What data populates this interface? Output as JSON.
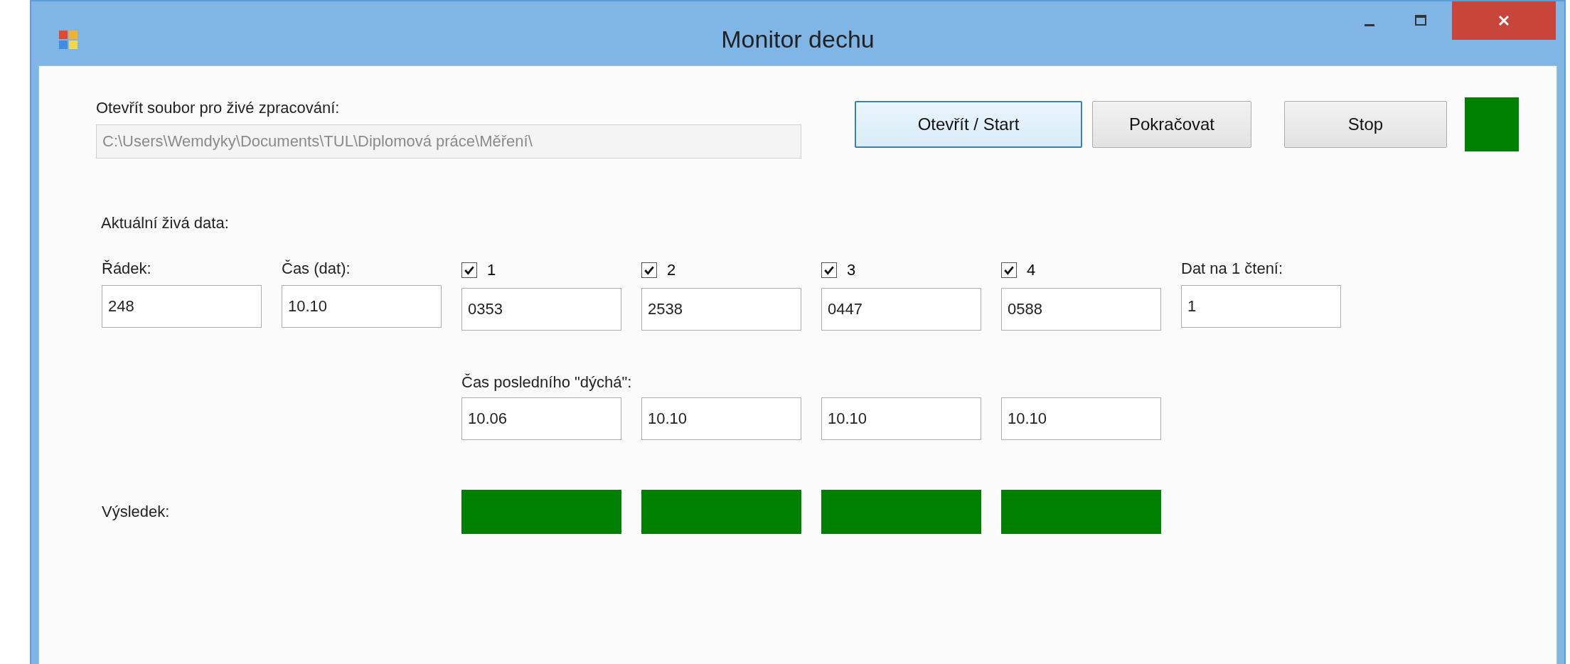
{
  "window": {
    "title": "Monitor dechu"
  },
  "file": {
    "label": "Otevřít soubor pro živé zpracování:",
    "value": "C:\\Users\\Wemdyky\\Documents\\TUL\\Diplomová práce\\Měření\\",
    "disabled": true
  },
  "buttons": [
    "Otevřít / Start",
    "Pokračovat",
    "Stop"
  ],
  "status": {
    "color": "#008000"
  },
  "live": {
    "heading": "Aktuální živá data:",
    "row": {
      "label": "Řádek:",
      "value": "248"
    },
    "time": {
      "label": "Čas (dat):",
      "value": "10.10"
    },
    "channels": [
      {
        "label": "1",
        "checked": true,
        "value": "0353",
        "last": "10.06",
        "color": "#008000"
      },
      {
        "label": "2",
        "checked": true,
        "value": "2538",
        "last": "10.10",
        "color": "#008000"
      },
      {
        "label": "3",
        "checked": true,
        "value": "0447",
        "last": "10.10",
        "color": "#008000"
      },
      {
        "label": "4",
        "checked": true,
        "value": "0588",
        "last": "10.10",
        "color": "#008000"
      }
    ],
    "per_read": {
      "label": "Dat na 1 čtení:",
      "value": "1"
    }
  },
  "last_heading": "Čas posledního \"dýchá\":",
  "result_label": "Výsledek:"
}
